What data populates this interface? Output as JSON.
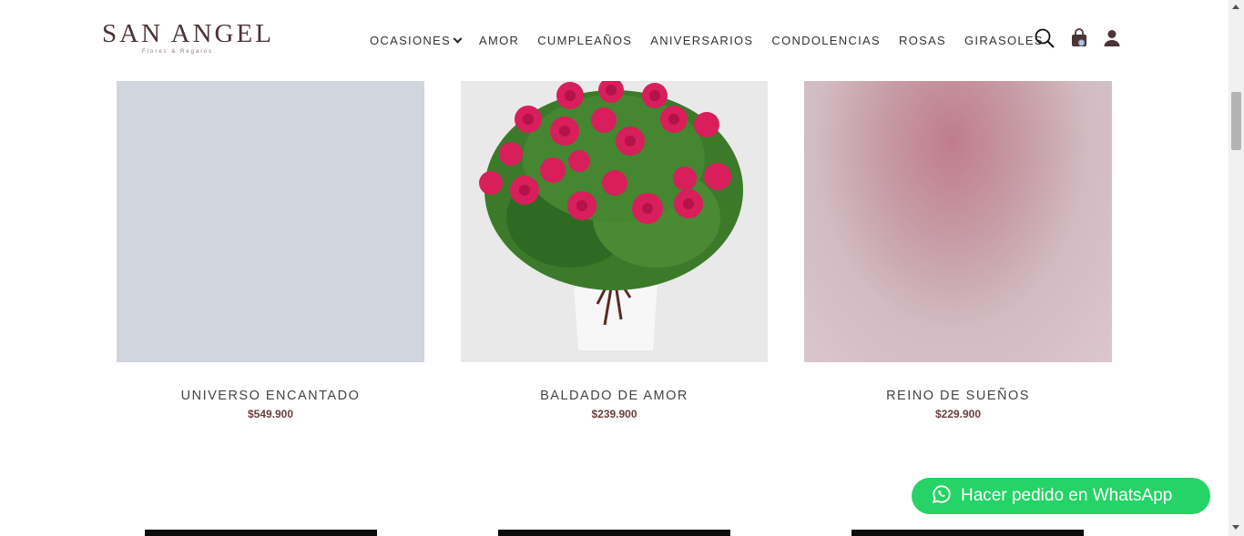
{
  "header": {
    "logo_text": "SAN ANGEL",
    "logo_subtitle": "Flores & Regalos",
    "nav": [
      {
        "label": "OCASIONES",
        "has_dropdown": true
      },
      {
        "label": "AMOR"
      },
      {
        "label": "CUMPLEAÑOS"
      },
      {
        "label": "ANIVERSARIOS"
      },
      {
        "label": "CONDOLENCIAS"
      },
      {
        "label": "ROSAS"
      },
      {
        "label": "GIRASOLES"
      }
    ],
    "icons": [
      "search-icon",
      "shopping-bag-icon",
      "user-icon"
    ],
    "cart_count": "0"
  },
  "products": [
    {
      "name": "UNIVERSO ENCANTADO",
      "price": "$549.900"
    },
    {
      "name": "BALDADO DE AMOR",
      "price": "$239.900"
    },
    {
      "name": "REINO DE SUEÑOS",
      "price": "$229.900"
    }
  ],
  "whatsapp": {
    "label": "Hacer pedido en WhatsApp",
    "icon": "whatsapp-icon",
    "color": "#25d366"
  },
  "colors": {
    "brand": "#4a3436",
    "price": "#6b3e3e"
  }
}
